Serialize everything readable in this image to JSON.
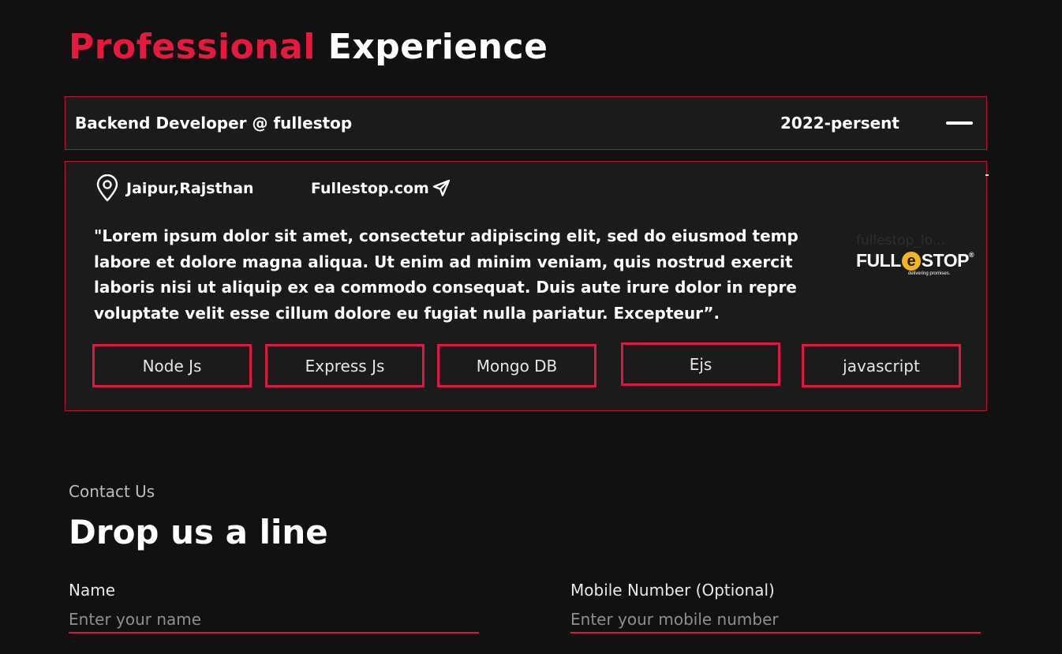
{
  "heading": {
    "accent": "Professional",
    "rest": "Experience"
  },
  "experience": {
    "title": "Backend Developer @ fullestop",
    "period": "2022-persent",
    "toggle_icon": "minus-icon",
    "location": "Jaipur,Rajsthan",
    "website": "Fullestop.com",
    "description": "\"Lorem ipsum dolor sit amet, consectetur adipiscing elit, sed do eiusmod temp\nlabore et dolore magna aliqua. Ut enim ad minim veniam, quis nostrud exercit\nlaboris nisi ut aliquip ex ea commodo consequat. Duis aute irure dolor in repre\nvoluptate velit esse cillum dolore eu fugiat nulla pariatur. Excepteur”.",
    "logo": {
      "alt_text": "fullestop_lo...",
      "brand_prefix": "FULL",
      "brand_e": "e",
      "brand_suffix": "STOP",
      "registered": "®",
      "tagline": "delivering promises."
    },
    "skills": [
      "Node Js",
      "Express Js",
      "Mongo DB",
      "Ejs",
      "javascript"
    ]
  },
  "contact": {
    "kicker": "Contact Us",
    "title": "Drop us a line",
    "name_label": "Name",
    "name_placeholder": "Enter your name",
    "mobile_label": "Mobile Number (Optional)",
    "mobile_placeholder": "Enter your mobile number"
  },
  "colors": {
    "accent": "#e8193f",
    "border": "#b0142f",
    "background": "#111111",
    "panel": "#1b1b1b",
    "logo_yellow": "#f3b61f"
  }
}
